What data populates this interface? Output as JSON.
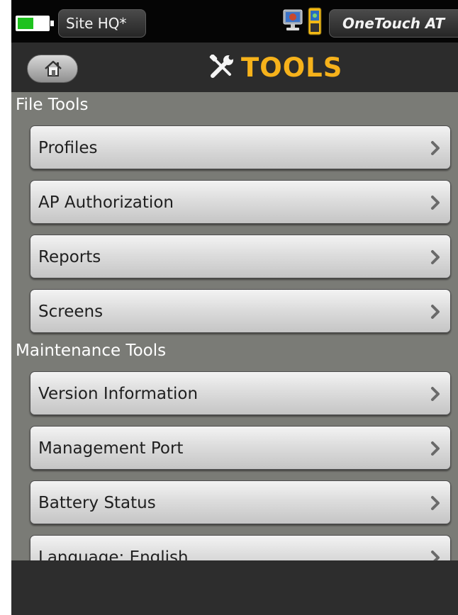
{
  "statusbar": {
    "site_label": "Site HQ*",
    "product_name": "OneTouch AT",
    "battery_color": "#1ec21e"
  },
  "header": {
    "title": "TOOLS",
    "title_color": "#f6b21b",
    "home_icon": "home-icon",
    "title_icon": "tools-icon"
  },
  "sections": {
    "file_tools": {
      "title": "File Tools",
      "items": [
        {
          "label": "Profiles"
        },
        {
          "label": "AP Authorization"
        },
        {
          "label": "Reports"
        },
        {
          "label": "Screens"
        }
      ]
    },
    "maintenance_tools": {
      "title": "Maintenance Tools",
      "items": [
        {
          "label": "Version Information"
        },
        {
          "label": "Management Port"
        },
        {
          "label": "Battery Status"
        },
        {
          "label": "Language: English"
        }
      ]
    }
  }
}
